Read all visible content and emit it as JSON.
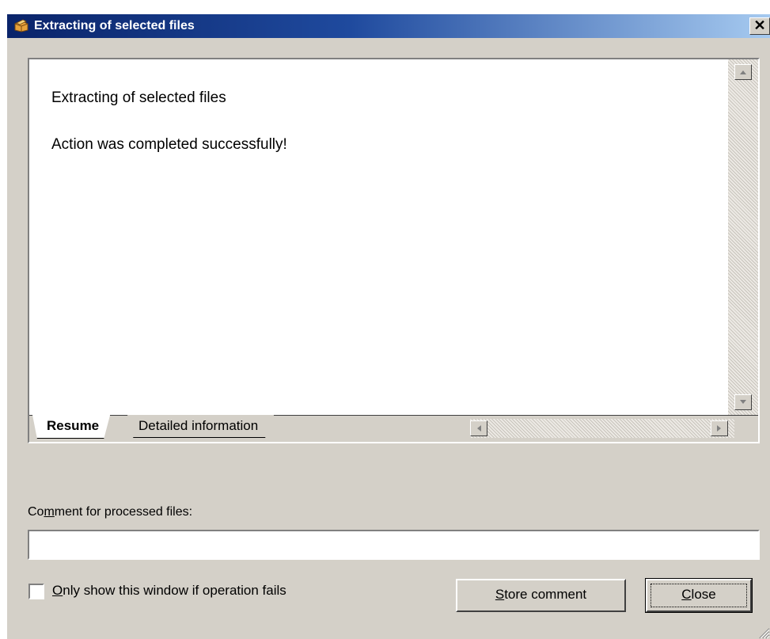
{
  "window": {
    "title": "Extracting of selected files",
    "close_symbol": "✕"
  },
  "result": {
    "heading": "Extracting of selected files",
    "message": "Action was completed successfully!"
  },
  "tabs": [
    {
      "label": "Resume",
      "active": true
    },
    {
      "label": "Detailed information",
      "active": false
    }
  ],
  "comment": {
    "label_pre": "Co",
    "label_mnemonic": "m",
    "label_post": "ment for processed files:",
    "value": "",
    "placeholder": ""
  },
  "checkbox": {
    "mnemonic": "O",
    "label_rest": "nly show this window if operation fails",
    "checked": false
  },
  "buttons": {
    "store_mnemonic": "S",
    "store_rest": "tore comment",
    "close_mnemonic": "C",
    "close_rest": "lose"
  },
  "icons": {
    "title": "archive-box-icon",
    "scroll_up": "arrow-up-icon",
    "scroll_down": "arrow-down-icon",
    "scroll_left": "arrow-left-icon",
    "scroll_right": "arrow-right-icon",
    "resize": "resize-grip-icon"
  },
  "colors": {
    "titlebar_start": "#0a246a",
    "titlebar_end": "#a6caf0",
    "face": "#d4d0c8"
  }
}
